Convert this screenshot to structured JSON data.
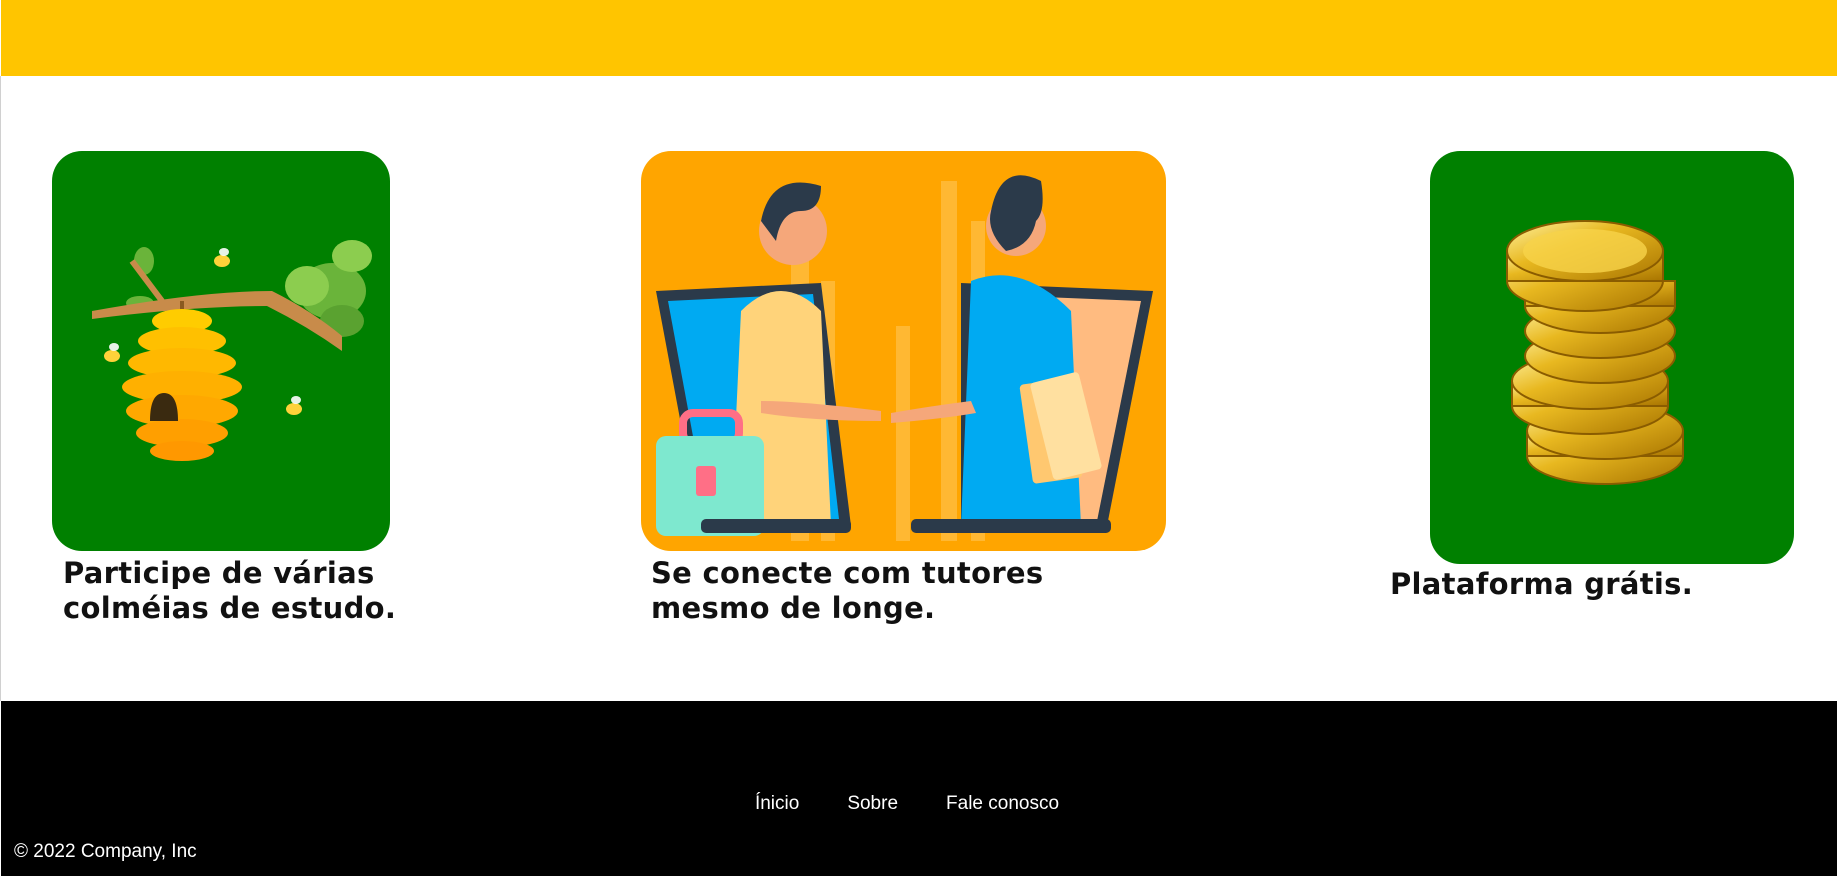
{
  "header": {
    "accent_color": "#ffc500"
  },
  "features": [
    {
      "caption": "Participe de várias colméias de estudo.",
      "image": "beehive-illustration",
      "background": "#008000"
    },
    {
      "caption": "Se conecte com tutores mesmo de longe.",
      "image": "handshake-laptops-illustration",
      "background": "#ffa500"
    },
    {
      "caption": "Plataforma grátis.",
      "image": "gold-coins-illustration",
      "background": "#008000"
    }
  ],
  "footer": {
    "nav": [
      {
        "label": "Ínicio"
      },
      {
        "label": "Sobre"
      },
      {
        "label": "Fale conosco"
      }
    ],
    "copyright": "© 2022 Company, Inc"
  }
}
